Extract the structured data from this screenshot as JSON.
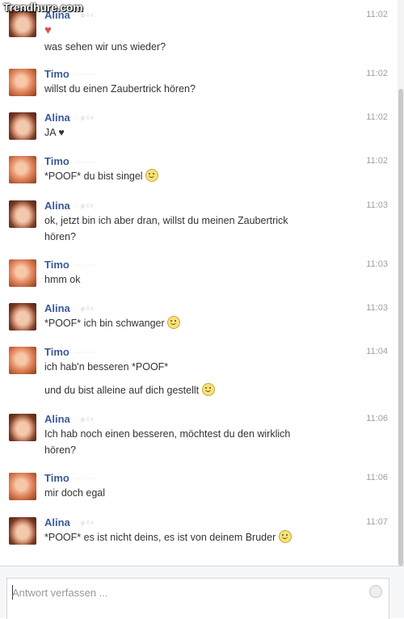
{
  "watermark": "Trendhure.com",
  "messages": [
    {
      "sender": "Alina",
      "sub": "· ·p·l·r",
      "time": "11:02",
      "lines": [
        "♥",
        "was sehen wir uns wieder?"
      ]
    },
    {
      "sender": "Timo",
      "sub": "·········",
      "time": "11:02",
      "lines": [
        "willst du einen Zaubertrick hören?"
      ]
    },
    {
      "sender": "Alina",
      "sub": "· ·p·l·r",
      "time": "11:02",
      "lines": [
        "JA ♥"
      ]
    },
    {
      "sender": "Timo",
      "sub": "·········",
      "time": "11:02",
      "lines": [
        "*POOF* du bist singel"
      ]
    },
    {
      "sender": "Alina",
      "sub": "· ·p·l·r",
      "time": "11:03",
      "lines": [
        "ok, jetzt bin ich aber dran, willst du meinen Zaubertrick",
        "hören?"
      ]
    },
    {
      "sender": "Timo",
      "sub": "·········",
      "time": "11:03",
      "lines": [
        "hmm ok"
      ]
    },
    {
      "sender": "Alina",
      "sub": "· ·p·l·r",
      "time": "11:03",
      "lines": [
        "*POOF* ich bin schwanger"
      ]
    },
    {
      "sender": "Timo",
      "sub": "·········",
      "time": "11:04",
      "lines": [
        "ich hab'n besseren *POOF*",
        "und du bist alleine auf dich gestellt"
      ]
    },
    {
      "sender": "Alina",
      "sub": "· ·p·l·r",
      "time": "11:06",
      "lines": [
        "Ich hab noch einen besseren, möchtest du den wirklich",
        "hören?"
      ]
    },
    {
      "sender": "Timo",
      "sub": "·········",
      "time": "11:06",
      "lines": [
        "mir doch egal"
      ]
    },
    {
      "sender": "Alina",
      "sub": "· ·p·l·r",
      "time": "11:07",
      "lines": [
        "*POOF* es ist nicht deins, es ist von deinem Bruder"
      ]
    }
  ],
  "composer": {
    "placeholder": "Antwort verfassen ..."
  },
  "colors": {
    "name": "#3b5998",
    "time": "#a0a0a0",
    "heart": "#d9534f"
  }
}
